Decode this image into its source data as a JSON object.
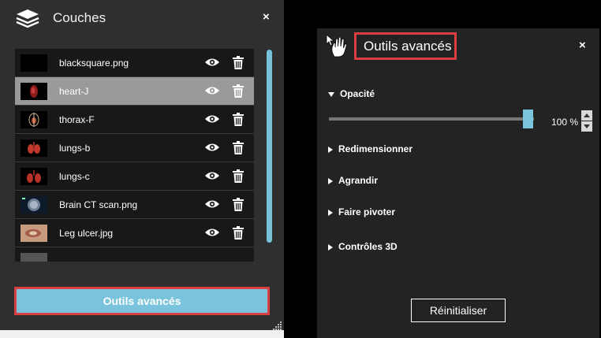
{
  "layers_panel": {
    "title": "Couches",
    "close_label": "×",
    "layers": [
      {
        "name": "blacksquare.png",
        "selected": false
      },
      {
        "name": "heart-J",
        "selected": true
      },
      {
        "name": "thorax-F",
        "selected": false
      },
      {
        "name": "lungs-b",
        "selected": false
      },
      {
        "name": "lungs-c",
        "selected": false
      },
      {
        "name": "Brain CT scan.png",
        "selected": false
      },
      {
        "name": "Leg ulcer.jpg",
        "selected": false
      }
    ],
    "advanced_button": "Outils avancés"
  },
  "tools_panel": {
    "title": "Outils avancés",
    "close_label": "×",
    "opacity": {
      "label": "Opacité",
      "value_text": "100 %",
      "value_percent": 100
    },
    "sections": [
      "Redimensionner",
      "Agrandir",
      "Faire pivoter",
      "Contrôles 3D"
    ],
    "reset_button": "Réinitialiser"
  },
  "colors": {
    "accent": "#79c4dc",
    "highlight_border": "#d9403f",
    "panel_bg": "#2f2f2f",
    "selected_row": "#9a9a9a"
  }
}
